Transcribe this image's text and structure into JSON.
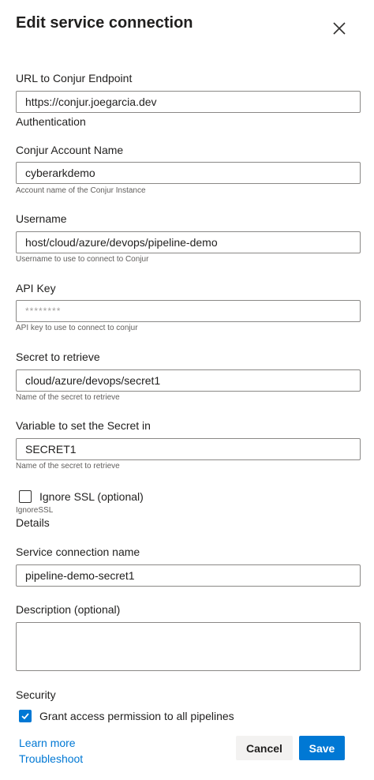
{
  "dialog": {
    "title": "Edit service connection"
  },
  "fields": {
    "url": {
      "label": "URL to Conjur Endpoint",
      "value": "https://conjur.joegarcia.dev"
    },
    "account": {
      "label": "Conjur Account Name",
      "value": "cyberarkdemo",
      "hint": "Account name of the Conjur Instance"
    },
    "username": {
      "label": "Username",
      "value": "host/cloud/azure/devops/pipeline-demo",
      "hint": "Username to use to connect to Conjur"
    },
    "api_key": {
      "label": "API Key",
      "value": "********",
      "hint": "API key to use to connect to conjur"
    },
    "secret": {
      "label": "Secret to retrieve",
      "value": "cloud/azure/devops/secret1",
      "hint": "Name of the secret to retrieve"
    },
    "variable": {
      "label": "Variable to set the Secret in",
      "value": "SECRET1",
      "hint": "Name of the secret to retrieve"
    },
    "ignore_ssl": {
      "label": "Ignore SSL (optional)",
      "hint": "IgnoreSSL",
      "checked": false
    },
    "connection_name": {
      "label": "Service connection name",
      "value": "pipeline-demo-secret1"
    },
    "description": {
      "label": "Description (optional)",
      "value": ""
    }
  },
  "sections": {
    "authentication": "Authentication",
    "details": "Details",
    "security": "Security"
  },
  "security": {
    "grant_label": "Grant access permission to all pipelines",
    "checked": true
  },
  "footer": {
    "learn_more": "Learn more",
    "troubleshoot": "Troubleshoot",
    "cancel": "Cancel",
    "save": "Save"
  },
  "colors": {
    "accent": "#0078d4",
    "text": "#201f1e",
    "hint": "#605e5c",
    "border": "#8a8886"
  }
}
